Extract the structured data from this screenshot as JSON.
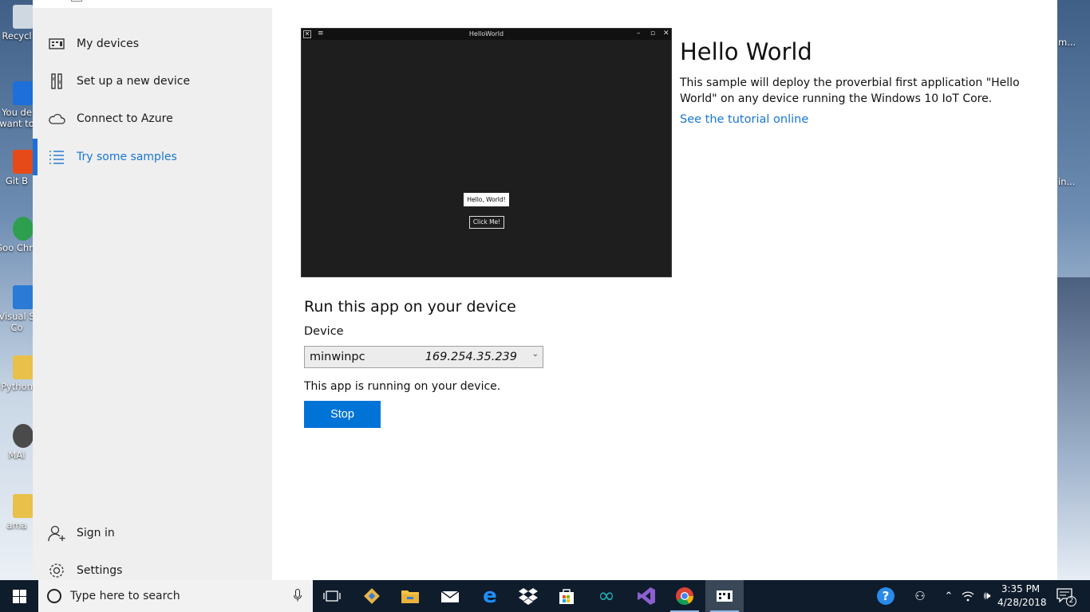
{
  "desktop": {
    "icons": [
      {
        "label": "Recycl",
        "color": "#cfd8e0"
      },
      {
        "label": "You de want to",
        "color": "#1e6fd9"
      },
      {
        "label": "Git B",
        "color": "#e64a19"
      },
      {
        "label": "Goo Chro",
        "color": "#2e9e4f"
      },
      {
        "label": "Visual S Co",
        "color": "#2a7ad6"
      },
      {
        "label": "Python",
        "color": "#e8c04a"
      },
      {
        "label": "MAI",
        "color": "#4a4a4a"
      },
      {
        "label": "ama",
        "color": "#e8c04a"
      }
    ],
    "right_labels": [
      "m...",
      "in..."
    ]
  },
  "sidebar": {
    "items": [
      {
        "label": "My devices",
        "icon": "devices-icon",
        "active": false
      },
      {
        "label": "Set up a new device",
        "icon": "tools-icon",
        "active": false
      },
      {
        "label": "Connect to Azure",
        "icon": "cloud-icon",
        "active": false
      },
      {
        "label": "Try some samples",
        "icon": "list-icon",
        "active": true
      }
    ],
    "bottom": [
      {
        "label": "Sign in",
        "icon": "add-user-icon"
      },
      {
        "label": "Settings",
        "icon": "gear-icon"
      }
    ]
  },
  "preview": {
    "window_title": "HelloWorld",
    "hello_text": "Hello, World!",
    "button_text": "Click Me!"
  },
  "sample": {
    "title": "Hello World",
    "description": "This sample will deploy the proverbial first application \"Hello World\" on any device running the Windows 10 IoT Core.",
    "link": "See the tutorial online"
  },
  "run": {
    "title": "Run this app on your device",
    "device_label": "Device",
    "device_name": "minwinpc",
    "device_ip": "169.254.35.239",
    "status": "This app is running on your device.",
    "stop_label": "Stop"
  },
  "taskbar": {
    "search_placeholder": "Type here to search",
    "time": "3:35 PM",
    "date": "4/28/2018",
    "notification_count": "2",
    "accent": "#0073d6"
  }
}
